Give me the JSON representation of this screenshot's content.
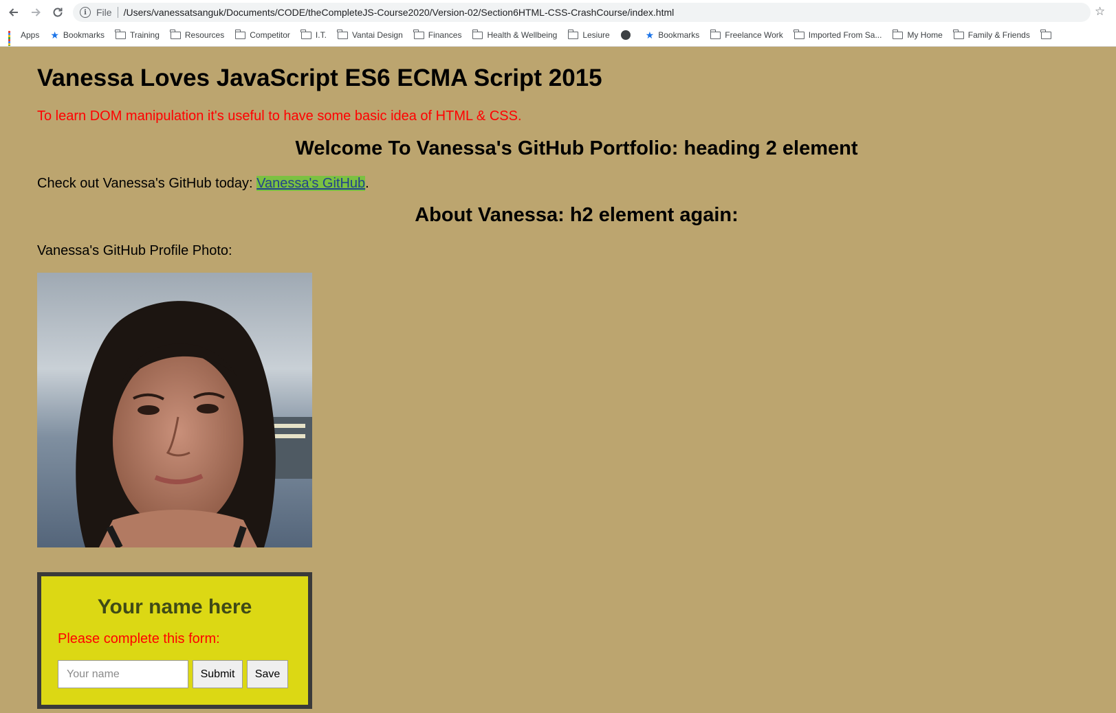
{
  "browser": {
    "scheme": "File",
    "url": "/Users/vanessatsanguk/Documents/CODE/theCompleteJS-Course2020/Version-02/Section6HTML-CSS-CrashCourse/index.html"
  },
  "bookmarks": [
    {
      "label": "Apps",
      "icon": "apps-grid-icon"
    },
    {
      "label": "Bookmarks",
      "icon": "star-icon"
    },
    {
      "label": "Training",
      "icon": "folder-icon"
    },
    {
      "label": "Resources",
      "icon": "folder-icon"
    },
    {
      "label": "Competitor",
      "icon": "folder-icon"
    },
    {
      "label": "I.T.",
      "icon": "folder-icon"
    },
    {
      "label": "Vantai Design",
      "icon": "folder-icon"
    },
    {
      "label": "Finances",
      "icon": "folder-icon"
    },
    {
      "label": "Health & Wellbeing",
      "icon": "folder-icon"
    },
    {
      "label": "Lesiure",
      "icon": "folder-icon"
    },
    {
      "label": "",
      "icon": "globe-icon"
    },
    {
      "label": "Bookmarks",
      "icon": "star-icon"
    },
    {
      "label": "Freelance Work",
      "icon": "folder-icon"
    },
    {
      "label": "Imported From Sa...",
      "icon": "folder-icon"
    },
    {
      "label": "My Home",
      "icon": "folder-icon"
    },
    {
      "label": "Family & Friends",
      "icon": "folder-icon"
    }
  ],
  "page": {
    "title": "Vanessa Loves JavaScript ES6 ECMA Script 2015",
    "intro": "To learn DOM manipulation it's useful to have some basic idea of HTML & CSS.",
    "welcome_heading": "Welcome To Vanessa's GitHub Portfolio: heading 2 element",
    "check_text": "Check out Vanessa's GitHub today: ",
    "github_link": "Vanessa's GitHub",
    "check_end": ".",
    "about_heading": "About Vanessa: h2 element again:",
    "photo_label": "Vanessa's GitHub Profile Photo:"
  },
  "form_card": {
    "heading": "Your name here",
    "prompt": "Please complete this form:",
    "name_placeholder": "Your name",
    "submit_label": "Submit",
    "save_label": "Save"
  },
  "colors": {
    "page_background": "#bca56f",
    "card_background": "#dcd814",
    "intro_text": "#ff0000",
    "link_highlight": "#7bc142"
  }
}
